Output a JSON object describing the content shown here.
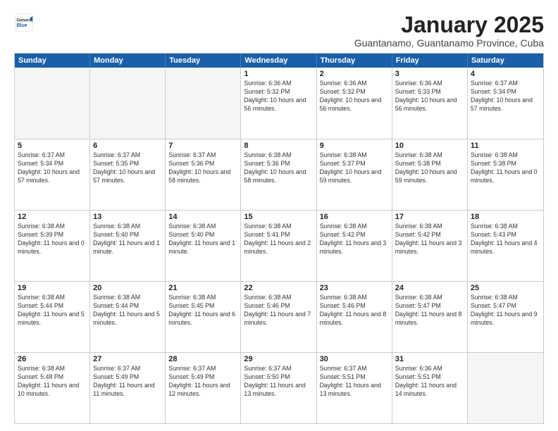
{
  "header": {
    "logo": {
      "general": "General",
      "blue": "Blue"
    },
    "title": "January 2025",
    "location": "Guantanamo, Guantanamo Province, Cuba"
  },
  "calendar": {
    "weekdays": [
      "Sunday",
      "Monday",
      "Tuesday",
      "Wednesday",
      "Thursday",
      "Friday",
      "Saturday"
    ],
    "rows": [
      [
        {
          "day": "",
          "empty": true
        },
        {
          "day": "",
          "empty": true
        },
        {
          "day": "",
          "empty": true
        },
        {
          "day": "1",
          "sunrise": "Sunrise: 6:36 AM",
          "sunset": "Sunset: 5:32 PM",
          "daylight": "Daylight: 10 hours and 56 minutes."
        },
        {
          "day": "2",
          "sunrise": "Sunrise: 6:36 AM",
          "sunset": "Sunset: 5:32 PM",
          "daylight": "Daylight: 10 hours and 56 minutes."
        },
        {
          "day": "3",
          "sunrise": "Sunrise: 6:36 AM",
          "sunset": "Sunset: 5:33 PM",
          "daylight": "Daylight: 10 hours and 56 minutes."
        },
        {
          "day": "4",
          "sunrise": "Sunrise: 6:37 AM",
          "sunset": "Sunset: 5:34 PM",
          "daylight": "Daylight: 10 hours and 57 minutes."
        }
      ],
      [
        {
          "day": "5",
          "sunrise": "Sunrise: 6:37 AM",
          "sunset": "Sunset: 5:34 PM",
          "daylight": "Daylight: 10 hours and 57 minutes."
        },
        {
          "day": "6",
          "sunrise": "Sunrise: 6:37 AM",
          "sunset": "Sunset: 5:35 PM",
          "daylight": "Daylight: 10 hours and 57 minutes."
        },
        {
          "day": "7",
          "sunrise": "Sunrise: 6:37 AM",
          "sunset": "Sunset: 5:36 PM",
          "daylight": "Daylight: 10 hours and 58 minutes."
        },
        {
          "day": "8",
          "sunrise": "Sunrise: 6:38 AM",
          "sunset": "Sunset: 5:36 PM",
          "daylight": "Daylight: 10 hours and 58 minutes."
        },
        {
          "day": "9",
          "sunrise": "Sunrise: 6:38 AM",
          "sunset": "Sunset: 5:37 PM",
          "daylight": "Daylight: 10 hours and 59 minutes."
        },
        {
          "day": "10",
          "sunrise": "Sunrise: 6:38 AM",
          "sunset": "Sunset: 5:38 PM",
          "daylight": "Daylight: 10 hours and 59 minutes."
        },
        {
          "day": "11",
          "sunrise": "Sunrise: 6:38 AM",
          "sunset": "Sunset: 5:38 PM",
          "daylight": "Daylight: 11 hours and 0 minutes."
        }
      ],
      [
        {
          "day": "12",
          "sunrise": "Sunrise: 6:38 AM",
          "sunset": "Sunset: 5:39 PM",
          "daylight": "Daylight: 11 hours and 0 minutes."
        },
        {
          "day": "13",
          "sunrise": "Sunrise: 6:38 AM",
          "sunset": "Sunset: 5:40 PM",
          "daylight": "Daylight: 11 hours and 1 minute."
        },
        {
          "day": "14",
          "sunrise": "Sunrise: 6:38 AM",
          "sunset": "Sunset: 5:40 PM",
          "daylight": "Daylight: 11 hours and 1 minute."
        },
        {
          "day": "15",
          "sunrise": "Sunrise: 6:38 AM",
          "sunset": "Sunset: 5:41 PM",
          "daylight": "Daylight: 11 hours and 2 minutes."
        },
        {
          "day": "16",
          "sunrise": "Sunrise: 6:38 AM",
          "sunset": "Sunset: 5:42 PM",
          "daylight": "Daylight: 11 hours and 3 minutes."
        },
        {
          "day": "17",
          "sunrise": "Sunrise: 6:38 AM",
          "sunset": "Sunset: 5:42 PM",
          "daylight": "Daylight: 11 hours and 3 minutes."
        },
        {
          "day": "18",
          "sunrise": "Sunrise: 6:38 AM",
          "sunset": "Sunset: 5:43 PM",
          "daylight": "Daylight: 11 hours and 4 minutes."
        }
      ],
      [
        {
          "day": "19",
          "sunrise": "Sunrise: 6:38 AM",
          "sunset": "Sunset: 5:44 PM",
          "daylight": "Daylight: 11 hours and 5 minutes."
        },
        {
          "day": "20",
          "sunrise": "Sunrise: 6:38 AM",
          "sunset": "Sunset: 5:44 PM",
          "daylight": "Daylight: 11 hours and 5 minutes."
        },
        {
          "day": "21",
          "sunrise": "Sunrise: 6:38 AM",
          "sunset": "Sunset: 5:45 PM",
          "daylight": "Daylight: 11 hours and 6 minutes."
        },
        {
          "day": "22",
          "sunrise": "Sunrise: 6:38 AM",
          "sunset": "Sunset: 5:46 PM",
          "daylight": "Daylight: 11 hours and 7 minutes."
        },
        {
          "day": "23",
          "sunrise": "Sunrise: 6:38 AM",
          "sunset": "Sunset: 5:46 PM",
          "daylight": "Daylight: 11 hours and 8 minutes."
        },
        {
          "day": "24",
          "sunrise": "Sunrise: 6:38 AM",
          "sunset": "Sunset: 5:47 PM",
          "daylight": "Daylight: 11 hours and 8 minutes."
        },
        {
          "day": "25",
          "sunrise": "Sunrise: 6:38 AM",
          "sunset": "Sunset: 5:47 PM",
          "daylight": "Daylight: 11 hours and 9 minutes."
        }
      ],
      [
        {
          "day": "26",
          "sunrise": "Sunrise: 6:38 AM",
          "sunset": "Sunset: 5:48 PM",
          "daylight": "Daylight: 11 hours and 10 minutes."
        },
        {
          "day": "27",
          "sunrise": "Sunrise: 6:37 AM",
          "sunset": "Sunset: 5:49 PM",
          "daylight": "Daylight: 11 hours and 11 minutes."
        },
        {
          "day": "28",
          "sunrise": "Sunrise: 6:37 AM",
          "sunset": "Sunset: 5:49 PM",
          "daylight": "Daylight: 11 hours and 12 minutes."
        },
        {
          "day": "29",
          "sunrise": "Sunrise: 6:37 AM",
          "sunset": "Sunset: 5:50 PM",
          "daylight": "Daylight: 11 hours and 13 minutes."
        },
        {
          "day": "30",
          "sunrise": "Sunrise: 6:37 AM",
          "sunset": "Sunset: 5:51 PM",
          "daylight": "Daylight: 11 hours and 13 minutes."
        },
        {
          "day": "31",
          "sunrise": "Sunrise: 6:36 AM",
          "sunset": "Sunset: 5:51 PM",
          "daylight": "Daylight: 11 hours and 14 minutes."
        },
        {
          "day": "",
          "empty": true
        }
      ]
    ]
  }
}
